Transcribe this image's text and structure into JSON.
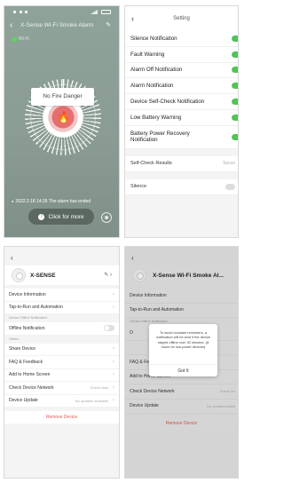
{
  "screen1": {
    "title": "X-Sense Wi-Fi Smoke Alarm",
    "wifi_label": "Wi-Fi",
    "status": "No Fire Danger",
    "log": "2022.2.18 14:35 The alarm has ended",
    "more": "Click for more",
    "flame_icon": "flame-icon",
    "accent": "#e56e6e"
  },
  "screen2": {
    "title": "Setting",
    "toggles": [
      {
        "label": "Silence Notification"
      },
      {
        "label": "Fault Warning"
      },
      {
        "label": "Alarm Off Notification"
      },
      {
        "label": "Alarm Notification"
      },
      {
        "label": "Device Self-Check Notification"
      },
      {
        "label": "Low Battery Warning"
      },
      {
        "label": "Battery Power Recovery Notification"
      }
    ],
    "self_check": {
      "label": "Self-Check Results",
      "value": "Succe"
    },
    "silence": {
      "label": "Silence"
    },
    "toggle_on_color": "#4fc556"
  },
  "screen3": {
    "device_name": "X-SENSE",
    "rows_top": [
      "Device Information",
      "Tap-to-Run and Automation"
    ],
    "offline_section": "Device Offline Notification",
    "offline_label": "Offline Notification",
    "others_section": "Others",
    "rows_bottom": [
      "Share Device",
      "FAQ & Feedback",
      "Add to Home Screen"
    ],
    "network": {
      "label": "Check Device Network",
      "value": "Check Now"
    },
    "update": {
      "label": "Device Update",
      "value": "No updates available"
    },
    "remove": "Remove Device",
    "remove_color": "#e05a4f"
  },
  "screen4": {
    "device_name": "X-Sense Wi-Fi Smoke Al...",
    "rows_top": [
      "Device Information",
      "Tap-to-Run and Automation"
    ],
    "offline_section": "Device Offline Notification",
    "offline_label": "O",
    "rows_bottom": [
      "FAQ & Feedback",
      "Add to Home Screen"
    ],
    "network": {
      "label": "Check Device Network",
      "value": "Check No"
    },
    "update": {
      "label": "Device Update",
      "value": "No updates availa"
    },
    "remove": "Remove Device",
    "dialog_message": "To avoid constant reminders, a notification will be sent if the device stayed offline over 30 minutes. (8 hours for low-power devices)",
    "dialog_ok": "Got It"
  }
}
